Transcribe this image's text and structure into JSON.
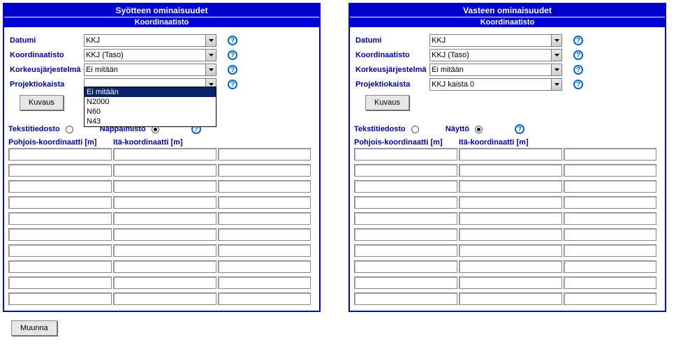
{
  "input": {
    "panel_title": "Syötteen ominaisuudet",
    "coord_header": "Koordinaatisto",
    "labels": {
      "datumi": "Datumi",
      "koord": "Koordinaatisto",
      "korkeus": "Korkeusjärjestelmä",
      "proj": "Projektiokaista"
    },
    "values": {
      "datumi": "KKJ",
      "koord": "KKJ (Taso)",
      "korkeus": "Ei mitään",
      "proj": ""
    },
    "korkeus_options": [
      "Ei mitään",
      "N2000",
      "N60",
      "N43"
    ],
    "kuvaus_btn": "Kuvaus",
    "mode": {
      "teksti": "Tekstitiedosto",
      "napp": "Näppäimistö"
    },
    "grid_headers": {
      "north": "Pohjois-koordinaatti [m]",
      "east": "Itä-koordinaatti [m]"
    }
  },
  "output": {
    "panel_title": "Vasteen ominaisuudet",
    "coord_header": "Koordinaatisto",
    "labels": {
      "datumi": "Datumi",
      "koord": "Koordinaatisto",
      "korkeus": "Korkeusjärjestelmä",
      "proj": "Projektiokaista"
    },
    "values": {
      "datumi": "KKJ",
      "koord": "KKJ (Taso)",
      "korkeus": "Ei mitään",
      "proj": "KKJ kaista 0"
    },
    "kuvaus_btn": "Kuvaus",
    "mode": {
      "teksti": "Tekstitiedosto",
      "naytto": "Näyttö"
    },
    "grid_headers": {
      "north": "Pohjois-koordinaatti [m]",
      "east": "Itä-koordinaatti [m]"
    }
  },
  "muunna": "Muunna",
  "help_glyph": "?"
}
